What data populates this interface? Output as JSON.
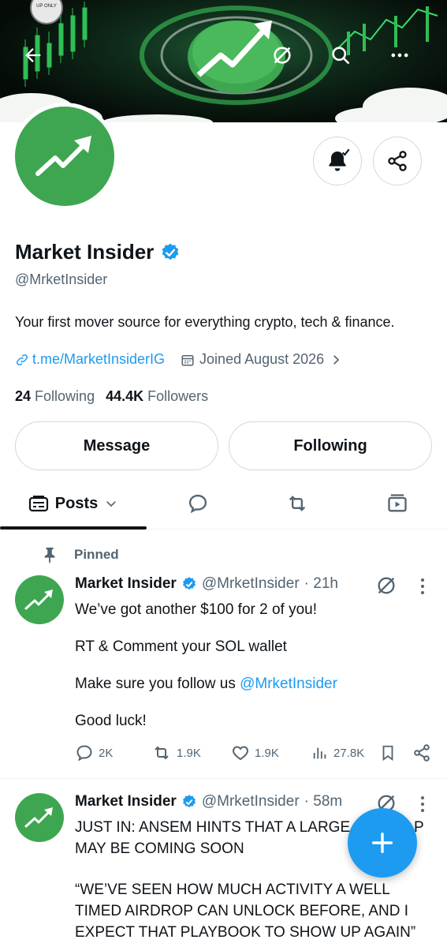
{
  "profile": {
    "display_name": "Market Insider",
    "handle": "@MrketInsider",
    "bio": "Your first mover source for everything crypto, tech & finance.",
    "link": "t.me/MarketInsiderIG",
    "joined": "Joined August 2026",
    "following_count": "24",
    "following_label": "Following",
    "followers_count": "44.4K",
    "followers_label": "Followers"
  },
  "buttons": {
    "message": "Message",
    "following": "Following"
  },
  "tabs": {
    "posts": "Posts"
  },
  "pinned_label": "Pinned",
  "tweets": [
    {
      "name": "Market Insider",
      "handle": "@MrketInsider",
      "time": "· 21h",
      "lines": [
        "We’ve got another $100 for 2 of you!",
        "RT & Comment your SOL wallet",
        "Make sure you follow us ",
        "Good luck!"
      ],
      "mention": "@MrketInsider",
      "replies": "2K",
      "reposts": "1.9K",
      "likes": "1.9K",
      "views": "27.8K"
    },
    {
      "name": "Market Insider",
      "handle": "@MrketInsider",
      "time": "· 58m",
      "line1": "JUST IN: ANSEM HINTS THAT A LARGE",
      "line1_tail": "P",
      "line2": "MAY BE COMING SOON",
      "line3": "“WE’VE SEEN HOW MUCH ACTIVITY A WELL",
      "line4": "TIMED AIRDROP CAN UNLOCK BEFORE, AND I",
      "line5": "EXPECT THAT PLAYBOOK TO SHOW UP AGAIN”"
    }
  ],
  "banner": {
    "badge": "UP ONLY"
  },
  "colors": {
    "accent": "#1d9bf0",
    "brand_green": "#3ea650",
    "text": "#0f1419",
    "muted": "#536471"
  }
}
